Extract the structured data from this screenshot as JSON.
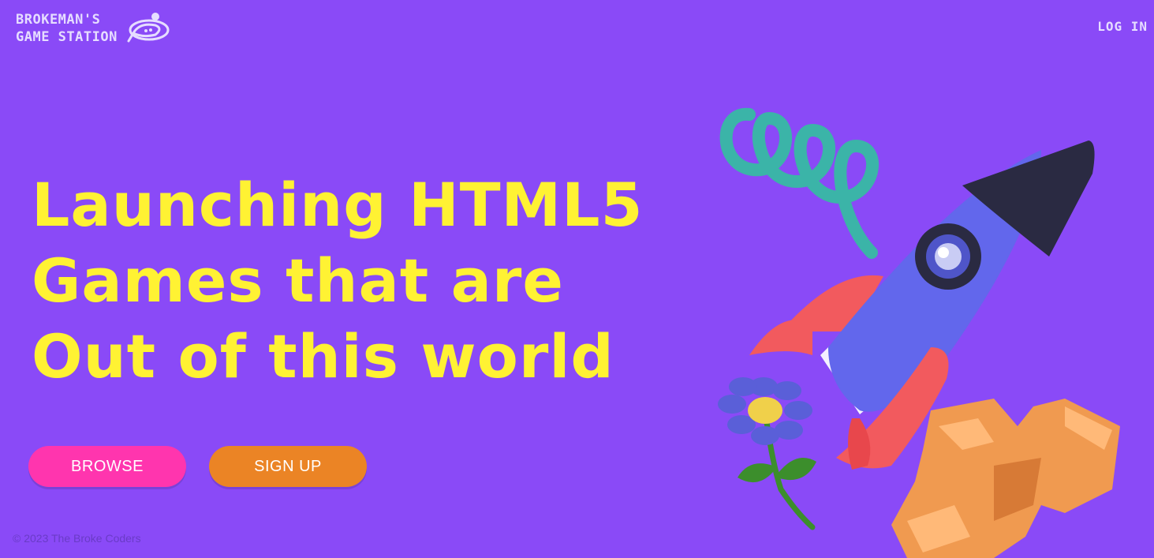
{
  "brand": {
    "line1": "BROKEMAN'S",
    "line2": "GAME STATION",
    "logo_icon": "spaceship-icon"
  },
  "nav": {
    "login_label": "LOG IN"
  },
  "hero": {
    "headline": [
      "Launching HTML5",
      "Games that are",
      "Out of this world"
    ],
    "illustration": "rocket-illustration"
  },
  "actions": {
    "browse_label": "BROWSE",
    "signup_label": "SIGN UP"
  },
  "footer": {
    "copyright": "© 2023 The Broke Coders"
  },
  "colors": {
    "background": "#8a4af7",
    "headline": "#fff233",
    "browse": "#ff35ae",
    "signup": "#eb8425"
  }
}
